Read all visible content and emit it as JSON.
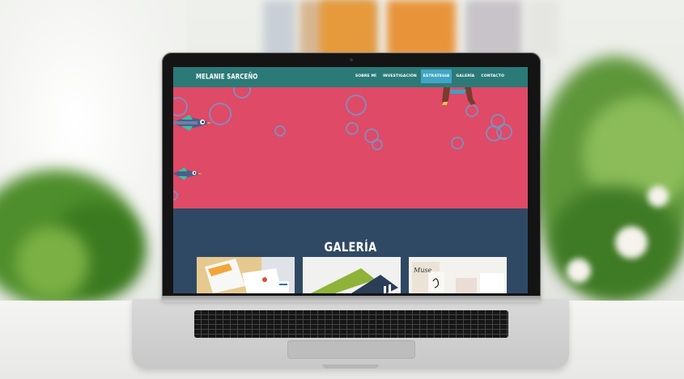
{
  "website": {
    "brand": "MELANIE SARCEÑO",
    "nav": [
      {
        "label": "SOBRE MÍ",
        "active": false
      },
      {
        "label": "INVESTIGACIÓN",
        "active": false
      },
      {
        "label": "ESTRATEGIA",
        "active": true
      },
      {
        "label": "GALERÍA",
        "active": false
      },
      {
        "label": "CONTACTO",
        "active": false
      }
    ],
    "gallery": {
      "title": "GALERÍA",
      "thumbnails": [
        {
          "name": "stationery-branding",
          "text": ""
        },
        {
          "name": "green-folder-design",
          "text": ""
        },
        {
          "name": "calligraphy-cards",
          "text": "Muse"
        }
      ]
    }
  },
  "colors": {
    "nav_bg": "#2b7a77",
    "nav_active": "#40a5c6",
    "hero_bg": "#df4a67",
    "gallery_bg": "#2f4964",
    "bubble": "#7f8fbf"
  },
  "icons": [
    "fish-illustration",
    "bubble-decoration",
    "legs-illustration"
  ]
}
